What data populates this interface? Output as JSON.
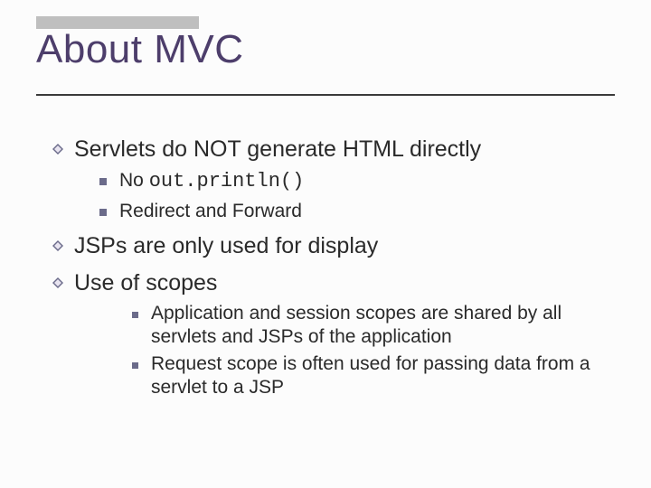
{
  "title": "About MVC",
  "points": {
    "p1": "Servlets do NOT generate HTML directly",
    "p1a_pre": "No ",
    "p1a_code": "out.println()",
    "p1b": "Redirect and Forward",
    "p2": "JSPs are only used for display",
    "p3": "Use of scopes",
    "p3a": "Application and session scopes are shared by all servlets and JSPs of the application",
    "p3b": "Request scope is often used for passing data from a servlet to a JSP"
  }
}
